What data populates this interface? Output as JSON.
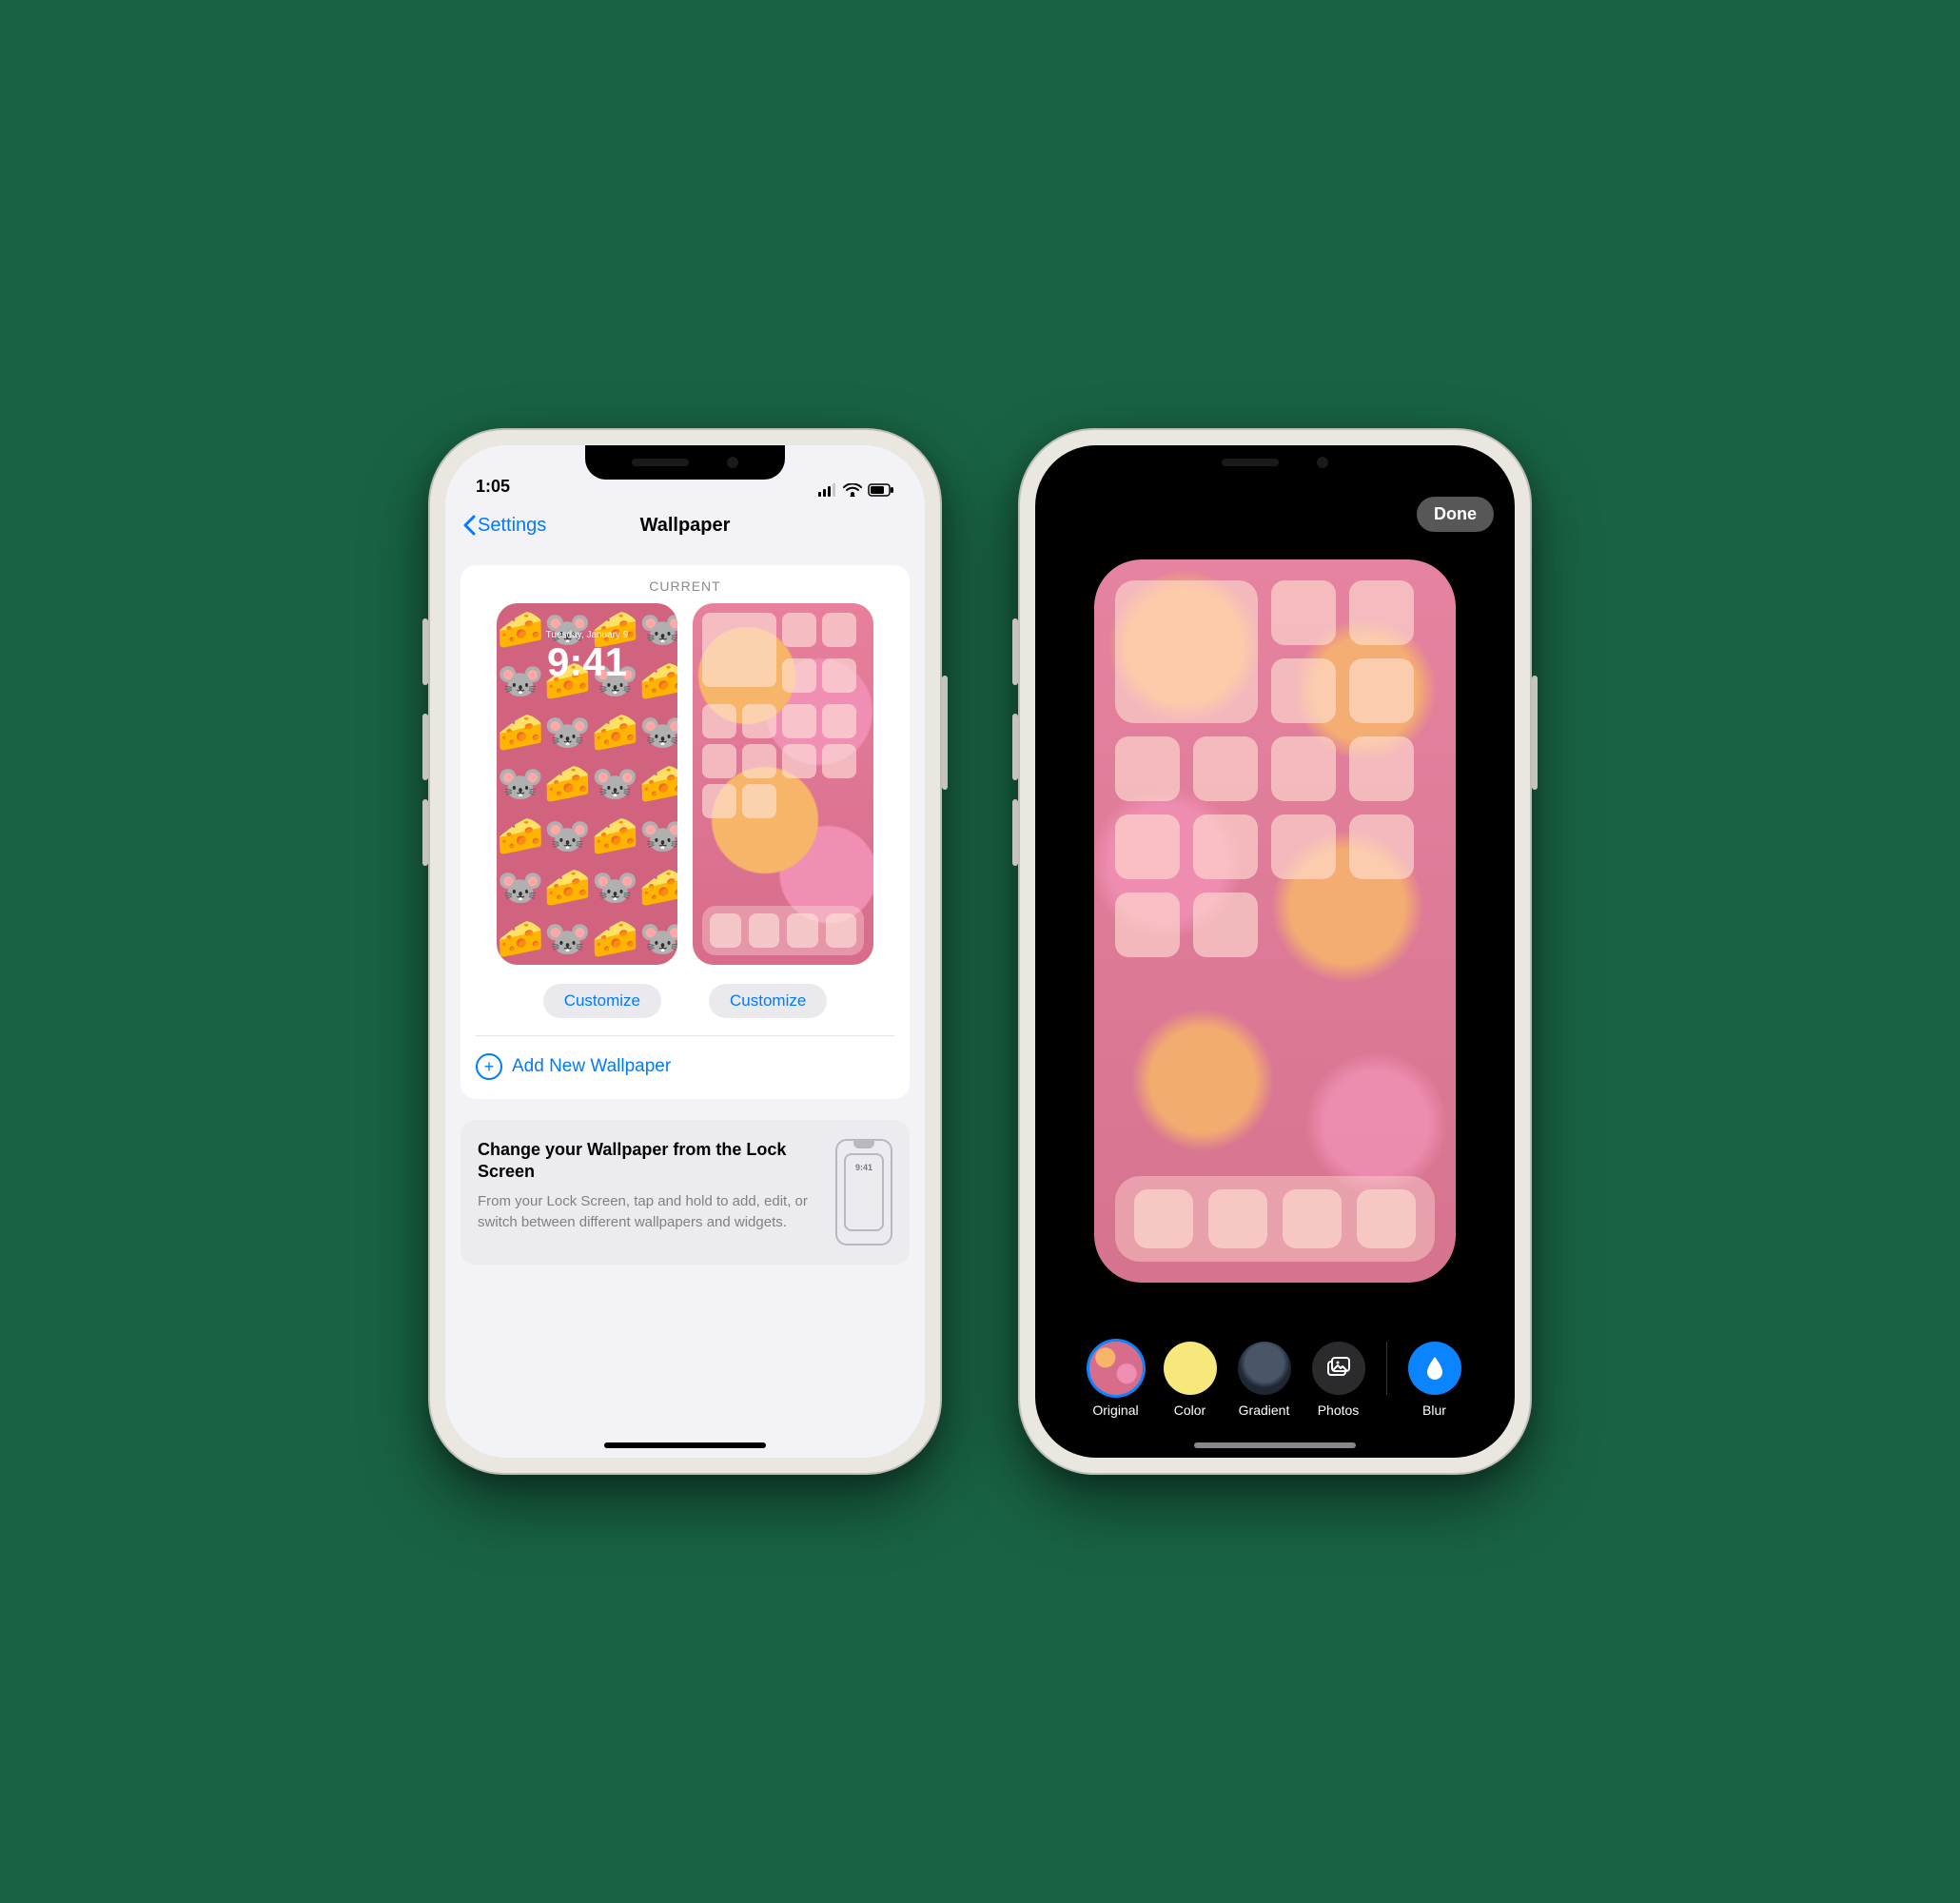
{
  "left": {
    "status": {
      "time": "1:05"
    },
    "nav": {
      "back": "Settings",
      "title": "Wallpaper"
    },
    "current": {
      "header": "CURRENT",
      "lock_preview": {
        "date": "Tuesday, January 9",
        "time": "9:41"
      },
      "customize_lock": "Customize",
      "customize_home": "Customize"
    },
    "add_new": "Add New Wallpaper",
    "hint": {
      "title": "Change your Wallpaper from the Lock Screen",
      "body": "From your Lock Screen, tap and hold to add, edit, or switch between different wallpapers and widgets.",
      "mini_time": "9:41"
    }
  },
  "right": {
    "done": "Done",
    "tools": {
      "original": "Original",
      "color": "Color",
      "gradient": "Gradient",
      "photos": "Photos",
      "blur": "Blur"
    }
  }
}
